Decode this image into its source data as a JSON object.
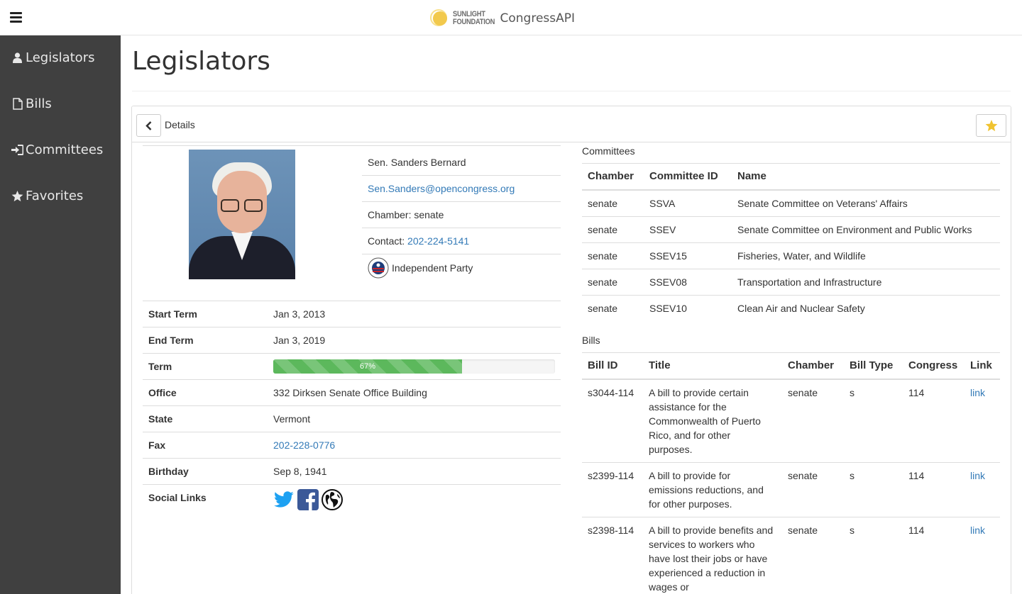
{
  "app": {
    "brand_primary": "SUNLIGHT",
    "brand_secondary": "FOUNDATION",
    "name": "CongressAPI"
  },
  "sidebar": {
    "items": [
      {
        "label": "Legislators",
        "icon": "user-icon"
      },
      {
        "label": "Bills",
        "icon": "file-icon"
      },
      {
        "label": "Committees",
        "icon": "sign-in-icon"
      },
      {
        "label": "Favorites",
        "icon": "star-icon"
      }
    ]
  },
  "page_title": "Legislators",
  "panel": {
    "header_label": "Details"
  },
  "legislator": {
    "name": "Sen. Sanders Bernard",
    "email": "Sen.Sanders@opencongress.org",
    "chamber_text": "Chamber: senate",
    "contact_label": "Contact:",
    "contact_phone": "202-224-5141",
    "party": "Independent Party",
    "details": {
      "start_term_label": "Start Term",
      "start_term": "Jan 3, 2013",
      "end_term_label": "End Term",
      "end_term": "Jan 3, 2019",
      "term_label": "Term",
      "term_progress": 67,
      "term_progress_text": "67%",
      "office_label": "Office",
      "office": "332 Dirksen Senate Office Building",
      "state_label": "State",
      "state": "Vermont",
      "fax_label": "Fax",
      "fax": "202-228-0776",
      "birthday_label": "Birthday",
      "birthday": "Sep 8, 1941",
      "social_label": "Social Links"
    }
  },
  "committees": {
    "label": "Committees",
    "headers": [
      "Chamber",
      "Committee ID",
      "Name"
    ],
    "rows": [
      [
        "senate",
        "SSVA",
        "Senate Committee on Veterans' Affairs"
      ],
      [
        "senate",
        "SSEV",
        "Senate Committee on Environment and Public Works"
      ],
      [
        "senate",
        "SSEV15",
        "Fisheries, Water, and Wildlife"
      ],
      [
        "senate",
        "SSEV08",
        "Transportation and Infrastructure"
      ],
      [
        "senate",
        "SSEV10",
        "Clean Air and Nuclear Safety"
      ]
    ]
  },
  "bills": {
    "label": "Bills",
    "headers": [
      "Bill ID",
      "Title",
      "Chamber",
      "Bill Type",
      "Congress",
      "Link"
    ],
    "rows": [
      {
        "id": "s3044-114",
        "title": "A bill to provide certain assistance for the Commonwealth of Puerto Rico, and for other purposes.",
        "chamber": "senate",
        "type": "s",
        "congress": "114",
        "link": "link"
      },
      {
        "id": "s2399-114",
        "title": "A bill to provide for emissions reductions, and for other purposes.",
        "chamber": "senate",
        "type": "s",
        "congress": "114",
        "link": "link"
      },
      {
        "id": "s2398-114",
        "title": "A bill to provide benefits and services to workers who have lost their jobs or have experienced a reduction in wages or",
        "chamber": "senate",
        "type": "s",
        "congress": "114",
        "link": "link"
      }
    ]
  },
  "colors": {
    "sidebar_bg": "#404040",
    "link": "#337ab7",
    "progress": "#5cb85c",
    "favorite_star": "#f0c330"
  }
}
